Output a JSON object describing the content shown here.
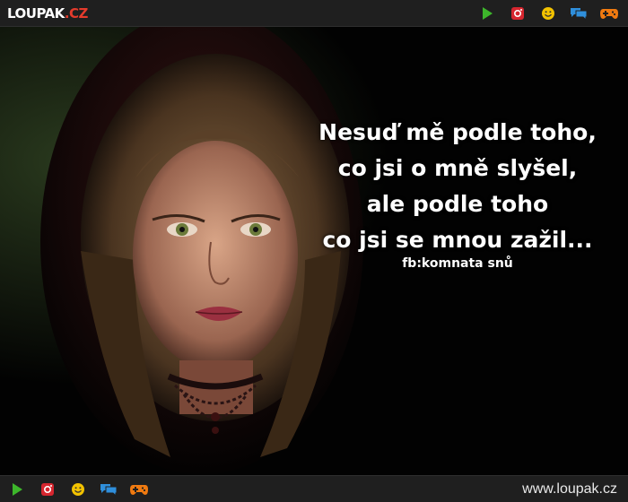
{
  "header": {
    "logo": {
      "main": "LOUPAK",
      "suffix": ".CZ"
    },
    "icons": [
      "play-icon",
      "instagram-icon",
      "smiley-icon",
      "chat-icon",
      "gamepad-icon"
    ]
  },
  "content": {
    "quote_lines": [
      "Nesuď mě podle toho,",
      "co jsi o mně slyšel,",
      "ale podle toho",
      "co jsi se mnou zažil..."
    ],
    "credit": "fb:komnata snů"
  },
  "footer": {
    "icons": [
      "play-icon",
      "instagram-icon",
      "smiley-icon",
      "chat-icon",
      "gamepad-icon"
    ],
    "site_url": "www.loupak.cz"
  },
  "colors": {
    "bar": "#1f1f1f",
    "logo_accent": "#e53b2c",
    "play": "#3db62b",
    "instagram": "#d6262f",
    "smiley": "#f2c200",
    "chat": "#2f8fdc",
    "gamepad": "#f07a10"
  }
}
